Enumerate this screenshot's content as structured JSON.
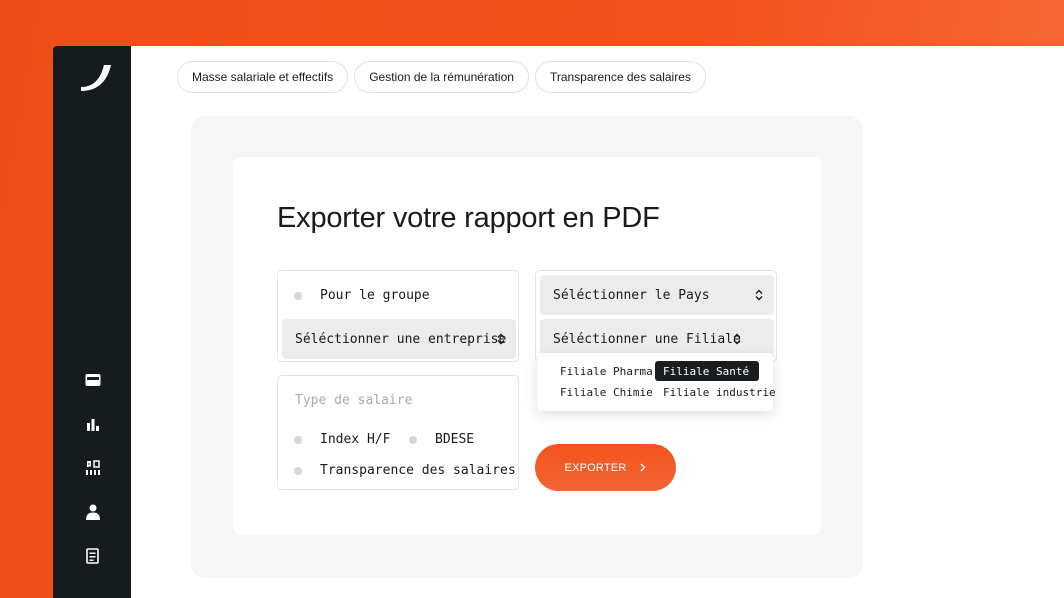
{
  "tabs": [
    {
      "label": "Masse salariale et effectifs"
    },
    {
      "label": "Gestion de la rémunération"
    },
    {
      "label": "Transparence des salaires"
    }
  ],
  "export": {
    "title": "Exporter votre rapport en PDF",
    "group_option": "Pour le groupe",
    "company_select": "Séléctionner une entreprise",
    "country_select": "Séléctionner le Pays",
    "subsidiary_select": "Séléctionner une Filiale",
    "subsidiaries": [
      {
        "label": "Filiale Pharma",
        "selected": false
      },
      {
        "label": "Filiale Santé",
        "selected": true
      },
      {
        "label": "Filiale Chimie",
        "selected": false
      },
      {
        "label": "Filiale industrie",
        "selected": false
      }
    ],
    "salary_type_placeholder": "Type de salaire",
    "salary_options": [
      {
        "label": "Index H/F"
      },
      {
        "label": "BDESE"
      },
      {
        "label": "Transparence des salaires"
      }
    ],
    "button_label": "EXPORTER",
    "button_icon": "chevron-right-icon"
  },
  "sidebar": {
    "logo": "brand-logo",
    "icons": [
      "wallet-icon",
      "bar-chart-icon",
      "grid-icon",
      "user-icon",
      "document-icon"
    ]
  },
  "colors": {
    "accent": "#f24d17",
    "sidebar_bg": "#161b1e",
    "selected_option_bg": "#1a1d20"
  }
}
